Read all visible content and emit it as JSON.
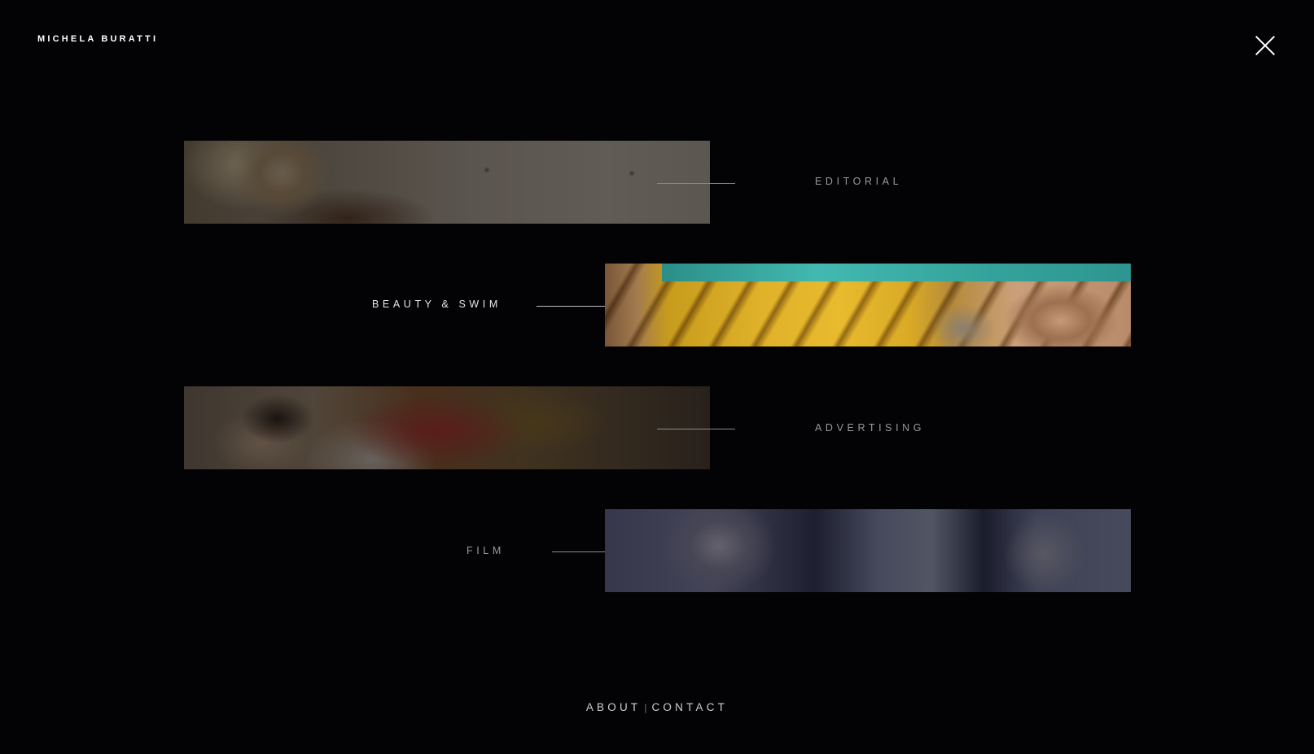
{
  "header": {
    "brand": "MICHELA BURATTI",
    "close_icon": "close-icon"
  },
  "menu": {
    "items": [
      {
        "label": "EDITORIAL",
        "image": "editorial-thumbnail",
        "active": false
      },
      {
        "label": "BEAUTY & SWIM",
        "image": "beauty-swim-thumbnail",
        "active": true
      },
      {
        "label": "ADVERTISING",
        "image": "advertising-thumbnail",
        "active": false
      },
      {
        "label": "FILM",
        "image": "film-thumbnail",
        "active": false
      }
    ]
  },
  "footer": {
    "about": "ABOUT",
    "separator": "|",
    "contact": "CONTACT"
  },
  "colors": {
    "background": "#030305",
    "text_active": "#e6e6e6",
    "text_inactive": "#9a9a9a"
  }
}
